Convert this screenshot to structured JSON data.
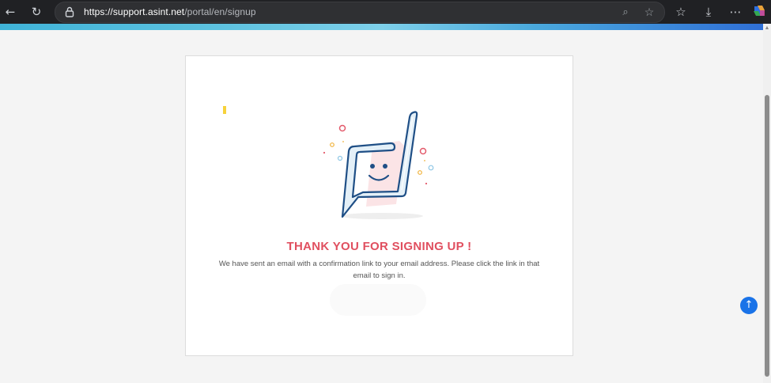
{
  "browser": {
    "url_host": "https://support.asint.net",
    "url_path": "/portal/en/signup",
    "icons": [
      "back-arrow-icon",
      "refresh-icon",
      "lock-icon",
      "zoom-icon",
      "star-icon",
      "favorites-icon",
      "download-icon",
      "more-icon",
      "copilot-icon"
    ]
  },
  "signup_confirmation": {
    "title": "THANK YOU FOR SIGNING UP !",
    "message": "We have sent an email with a confirmation link to your email address. Please click the link in that email to sign in."
  },
  "colors": {
    "title": "#e04f5f",
    "accent_blue": "#1a73e8",
    "toolbar_bg": "#202124",
    "page_bg": "#f4f4f4"
  }
}
